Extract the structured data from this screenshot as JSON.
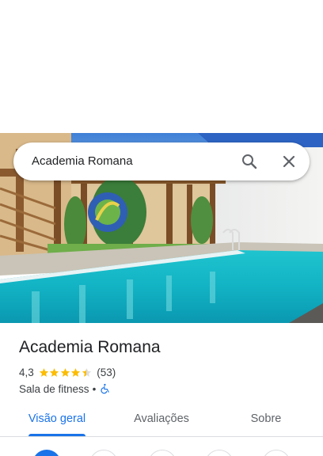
{
  "search": {
    "query": "Academia Romana"
  },
  "place": {
    "name": "Academia Romana",
    "rating": "4,3",
    "rating_stars": 4.3,
    "review_count": "(53)",
    "category": "Sala de fitness",
    "separator": "•"
  },
  "tabs": [
    {
      "label": "Visão geral",
      "active": true
    },
    {
      "label": "Avaliações",
      "active": false
    },
    {
      "label": "Sobre",
      "active": false
    }
  ],
  "colors": {
    "accent": "#1a73e8",
    "star": "#fbbc04",
    "text_primary": "#202124",
    "text_secondary": "#5f6368"
  },
  "icons": {
    "search": "search-icon",
    "close": "close-icon",
    "wheelchair": "wheelchair-accessible-icon"
  }
}
